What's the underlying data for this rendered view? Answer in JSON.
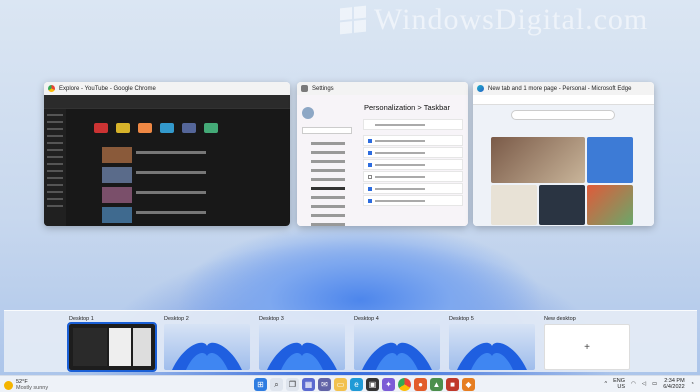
{
  "watermark": "WindowsDigital.com",
  "windows": [
    {
      "title": "Explore - YouTube - Google Chrome"
    },
    {
      "title": "Settings",
      "page_title": "Personalization  >  Taskbar"
    },
    {
      "title": "New tab and 1 more page - Personal - Microsoft Edge"
    }
  ],
  "desktops": [
    {
      "label": "Desktop 1"
    },
    {
      "label": "Desktop 2"
    },
    {
      "label": "Desktop 3"
    },
    {
      "label": "Desktop 4"
    },
    {
      "label": "Desktop 5"
    },
    {
      "label": "New desktop",
      "symbol": "+"
    }
  ],
  "taskbar": {
    "weather_temp": "52°F",
    "weather_desc": "Mostly sunny",
    "lang_line1": "ENG",
    "lang_line2": "US",
    "time": "2:34 PM",
    "date": "6/4/2022"
  },
  "colors": {
    "accent": "#1a5fd6"
  }
}
